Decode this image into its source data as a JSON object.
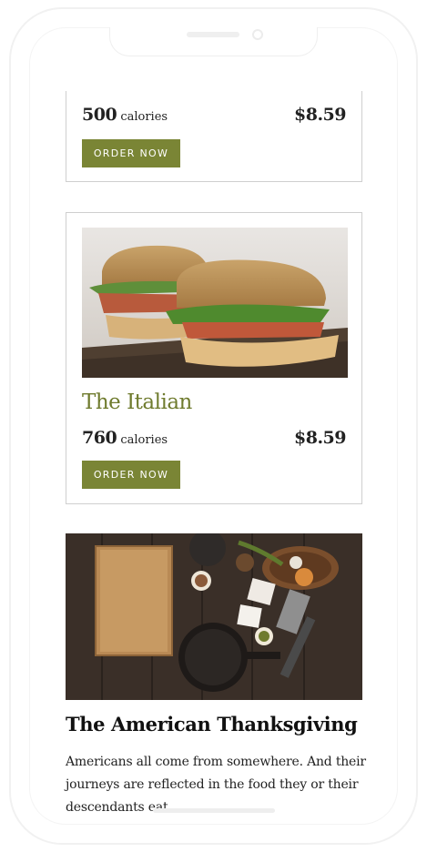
{
  "items": [
    {
      "title": "",
      "calories_num": "500",
      "calories_unit": "calories",
      "price": "$8.59",
      "order_label": "ORDER NOW"
    },
    {
      "title": "The Italian",
      "calories_num": "760",
      "calories_unit": "calories",
      "price": "$8.59",
      "order_label": "ORDER NOW"
    }
  ],
  "article": {
    "title": "The American Thanksgiving",
    "body": "Americans all come from somewhere. And their journeys are reflected in the food they or their descendants eat."
  },
  "colors": {
    "accent": "#7a8535",
    "title_green": "#6f7b2e",
    "border": "#cfcfcf"
  }
}
